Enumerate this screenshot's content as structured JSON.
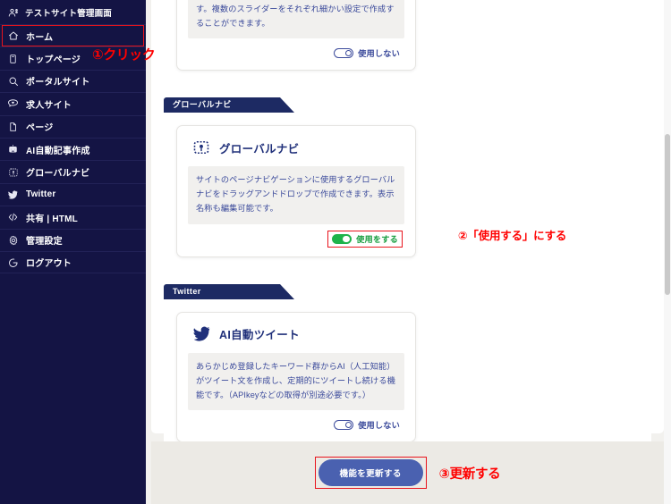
{
  "sidebar": {
    "brand": {
      "label": "テストサイト管理画面",
      "icon": "person-icon"
    },
    "items": [
      {
        "label": "ホーム",
        "icon": "home-icon",
        "active": true
      },
      {
        "label": "トップページ",
        "icon": "page-icon",
        "active": false
      },
      {
        "label": "ポータルサイト",
        "icon": "search-icon",
        "active": false
      },
      {
        "label": "求人サイト",
        "icon": "heart-chat-icon",
        "active": false
      },
      {
        "label": "ページ",
        "icon": "document-icon",
        "active": false
      },
      {
        "label": "AI自動記事作成",
        "icon": "robot-icon",
        "active": false
      },
      {
        "label": "グローバルナビ",
        "icon": "dragdrop-icon",
        "active": false
      },
      {
        "label": "Twitter",
        "icon": "twitter-icon",
        "active": false
      },
      {
        "label": "共有 | HTML",
        "icon": "code-icon",
        "active": false
      },
      {
        "label": "管理設定",
        "icon": "gear-icon",
        "active": false
      },
      {
        "label": "ログアウト",
        "icon": "logout-icon",
        "active": false
      }
    ]
  },
  "annotations": {
    "step1": "①クリック",
    "step2": "②「使用する」にする",
    "step3": "③更新する",
    "color": "#ff0000"
  },
  "sections": [
    {
      "partial": true,
      "card": {
        "description": "好きな場所に画像や動画のスライダーを表示できます。複数のスライダーをそれぞれ細かい設定で作成することができます。",
        "toggle": {
          "state": "off",
          "label": "使用しない",
          "highlighted": false
        }
      }
    },
    {
      "header": "グローバルナビ",
      "card": {
        "icon": "dragdrop-icon",
        "title": "グローバルナビ",
        "description": "サイトのページナビゲーションに使用するグローバルナビをドラッグアンドドロップで作成できます。表示名称も編集可能です。",
        "toggle": {
          "state": "on",
          "label": "使用をする",
          "highlighted": true
        }
      }
    },
    {
      "header": "Twitter",
      "card": {
        "icon": "twitter-icon",
        "title": "AI自動ツイート",
        "description": "あらかじめ登録したキーワード群からAI（人工知能）がツイート文を作成し、定期的にツイートし続ける機能です。（APIkeyなどの取得が別途必要です。）",
        "toggle": {
          "state": "off",
          "label": "使用しない",
          "highlighted": false
        }
      }
    }
  ],
  "footer": {
    "update_button": "機能を更新する",
    "button_highlighted": true
  },
  "colors": {
    "sidebar_bg": "#141444",
    "section_header_bg": "#1d2a63",
    "accent_blue": "#3b4a9b",
    "toggle_on_green": "#1fb34a",
    "annotation_red": "#ff0000",
    "button_blue": "#4a61b0",
    "page_bg": "#f2f1ee"
  }
}
